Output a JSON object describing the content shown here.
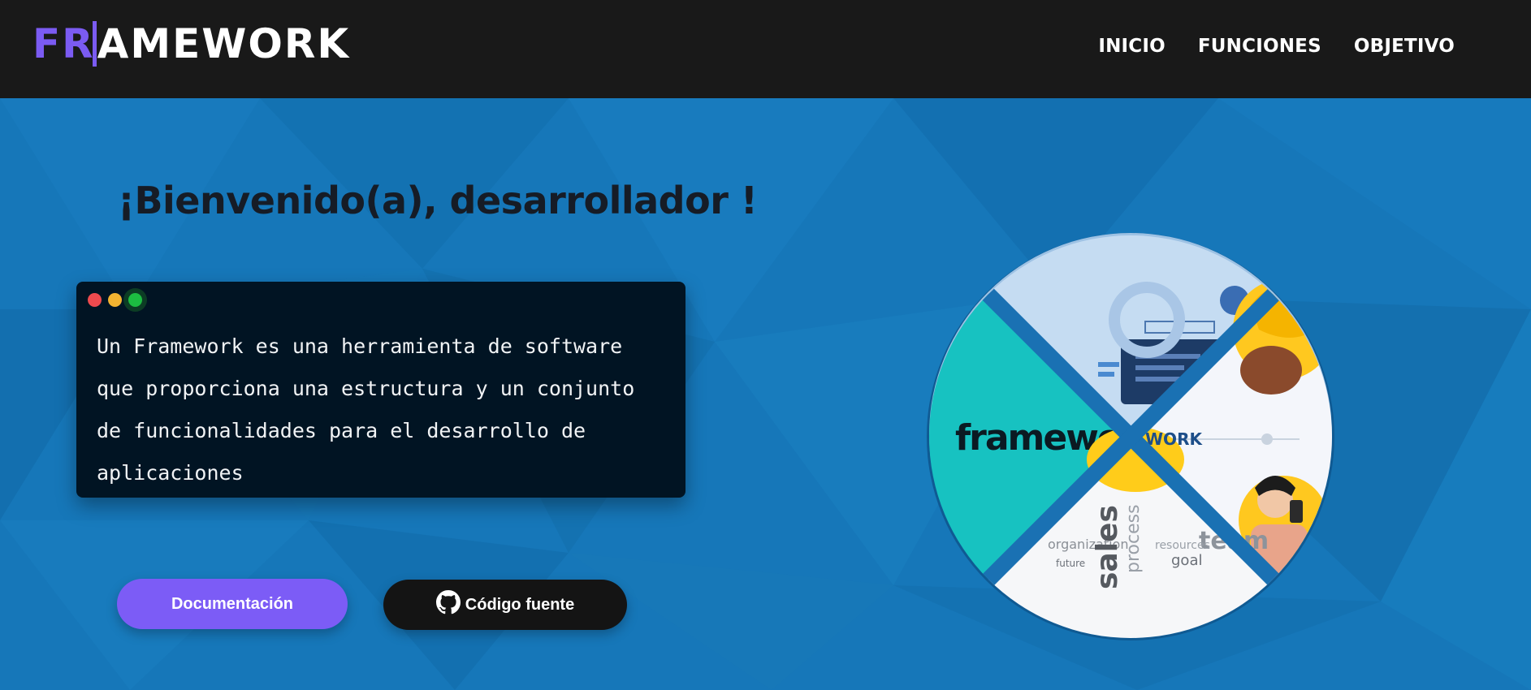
{
  "header": {
    "logo": {
      "accent": "FR",
      "rest": "AMEWORK"
    },
    "nav": [
      "INICIO",
      "FUNCIONES",
      "OBJETIVO"
    ]
  },
  "hero": {
    "title": "¡Bienvenido(a), desarrollador !",
    "terminal_lines": [
      "Un Framework es una herramienta de software",
      "que proporciona una estructura y un conjunto",
      "de funcionalidades para el desarrollo de",
      "aplicaciones"
    ],
    "buttons": {
      "docs": "Documentación",
      "source": "Código fuente"
    }
  },
  "illustration": {
    "label": "framework",
    "partial_label": "WORK",
    "words": [
      "sales",
      "process",
      "team",
      "goal",
      "future",
      "resources",
      "organization"
    ]
  },
  "colors": {
    "navbar": "#191919",
    "hero_bg": "#1476b8",
    "accent": "#7b5bf2",
    "terminal_bg": "#011423",
    "teal": "#17c2c1"
  },
  "icons": [
    "github-icon"
  ]
}
